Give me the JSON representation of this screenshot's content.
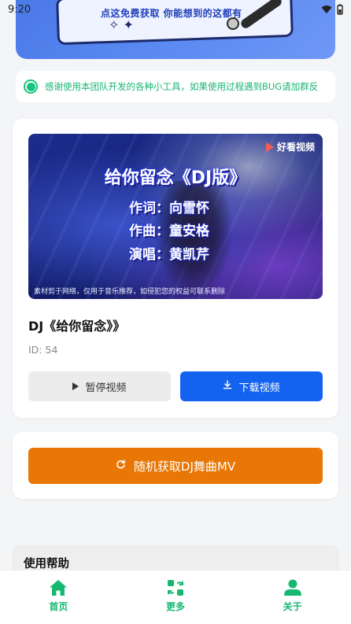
{
  "status_bar": {
    "time": "9:20"
  },
  "banner": {
    "text": "点这免费获取 你能想到的这都有"
  },
  "notice": {
    "text": "感谢使用本团队开发的各种小工具，如果使用过程遇到BUG请加群反"
  },
  "video": {
    "thumbnail": {
      "logo": "好看视频",
      "title": "给你留念《DJ版》",
      "lyricist": "作词：向雪怀",
      "composer": "作曲：童安格",
      "singer": "演唱：黄凯芹",
      "disclaimer": "素材剪于网络，仅用于音乐推荐，如侵犯您的权益可联系删除"
    },
    "title": "DJ《给你留念》》",
    "id_label": "ID: 54",
    "pause_label": "暂停视频",
    "download_label": "下载视频"
  },
  "random": {
    "label": "随机获取DJ舞曲MV"
  },
  "help": {
    "title": "使用帮助"
  },
  "tabs": [
    {
      "label": "首页",
      "icon": "home-icon"
    },
    {
      "label": "更多",
      "icon": "more-apps-icon"
    },
    {
      "label": "关于",
      "icon": "user-icon"
    }
  ],
  "colors": {
    "accent_green": "#16b870",
    "primary_blue": "#1463f0",
    "orange": "#e87705"
  }
}
